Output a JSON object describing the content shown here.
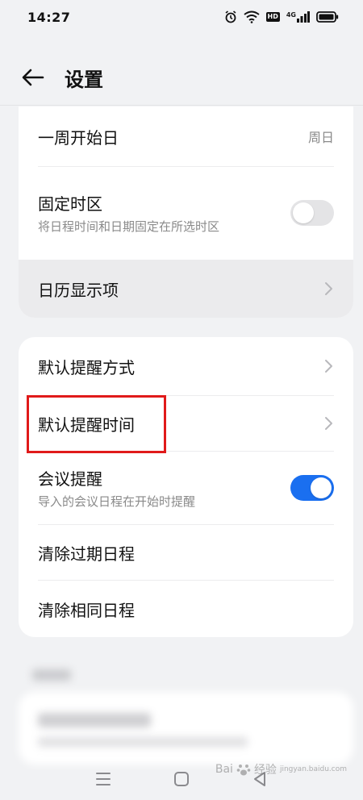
{
  "status_bar": {
    "time": "14:27",
    "icons": [
      "alarm-icon",
      "wifi-icon",
      "hd-icon",
      "signal-4g-icon",
      "battery-icon"
    ],
    "hd_label": "HD",
    "network_label": "4G"
  },
  "header": {
    "back_icon": "arrow-left-icon",
    "title": "设置"
  },
  "section_1": {
    "week_start": {
      "label": "一周开始日",
      "value": "周日"
    },
    "fixed_timezone": {
      "label": "固定时区",
      "description": "将日程时间和日期固定在所选时区",
      "enabled": false
    },
    "calendar_display": {
      "label": "日历显示项"
    }
  },
  "section_2": {
    "default_reminder_method": {
      "label": "默认提醒方式"
    },
    "default_reminder_time": {
      "label": "默认提醒时间"
    },
    "meeting_reminder": {
      "label": "会议提醒",
      "description": "导入的会议日程在开始时提醒",
      "enabled": true
    },
    "clear_expired": {
      "label": "清除过期日程"
    },
    "clear_duplicates": {
      "label": "清除相同日程"
    }
  },
  "nav_bar": {
    "icons": [
      "menu-icon",
      "home-square-icon",
      "back-triangle-icon"
    ]
  },
  "watermark": {
    "text": "Bai",
    "text2": "经验",
    "sub": "jingyan.baidu.com"
  },
  "colors": {
    "accent": "#1a6ff0",
    "annotation": "#e01a1a",
    "background": "#f1f2f4"
  }
}
